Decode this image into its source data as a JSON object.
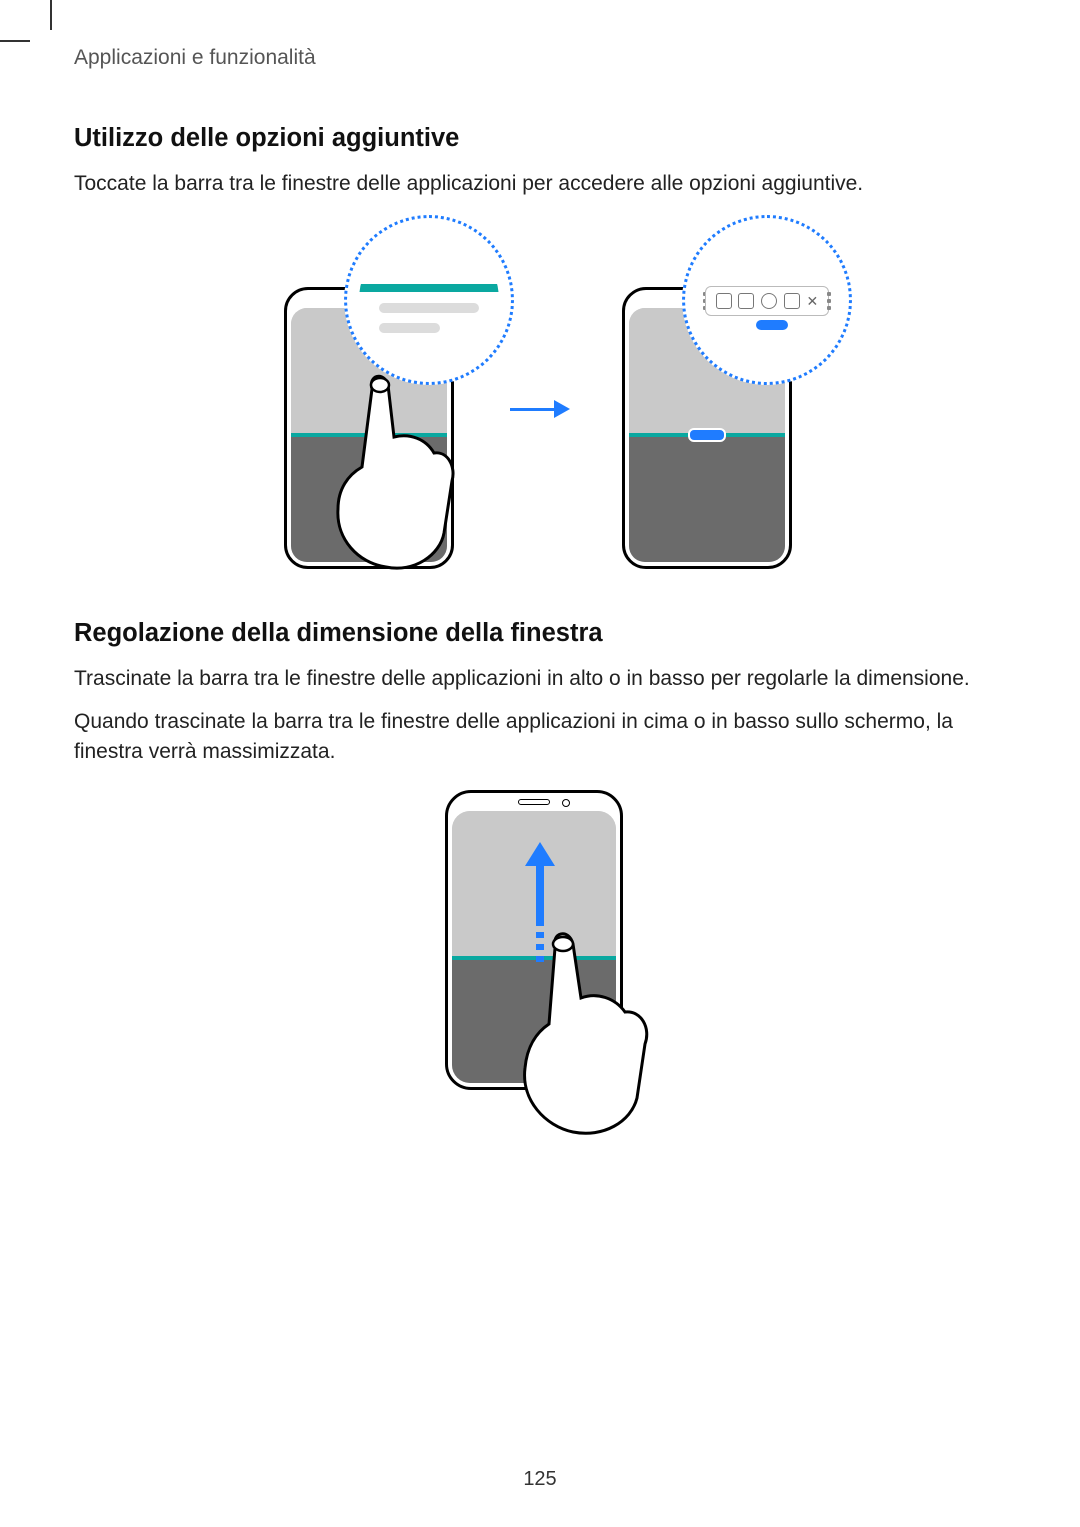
{
  "running_head": "Applicazioni e funzionalità",
  "section1": {
    "title": "Utilizzo delle opzioni aggiuntive",
    "body": "Toccate la barra tra le finestre delle applicazioni per accedere alle opzioni aggiuntive."
  },
  "section2": {
    "title": "Regolazione della dimensione della finestra",
    "body1": "Trascinate la barra tra le finestre delle applicazioni in alto o in basso per regolarle la dimensione.",
    "body2": "Quando trascinate la barra tra le finestre delle applicazioni in cima o in basso sullo schermo, la finestra verrà massimizzata."
  },
  "page_number": "125"
}
